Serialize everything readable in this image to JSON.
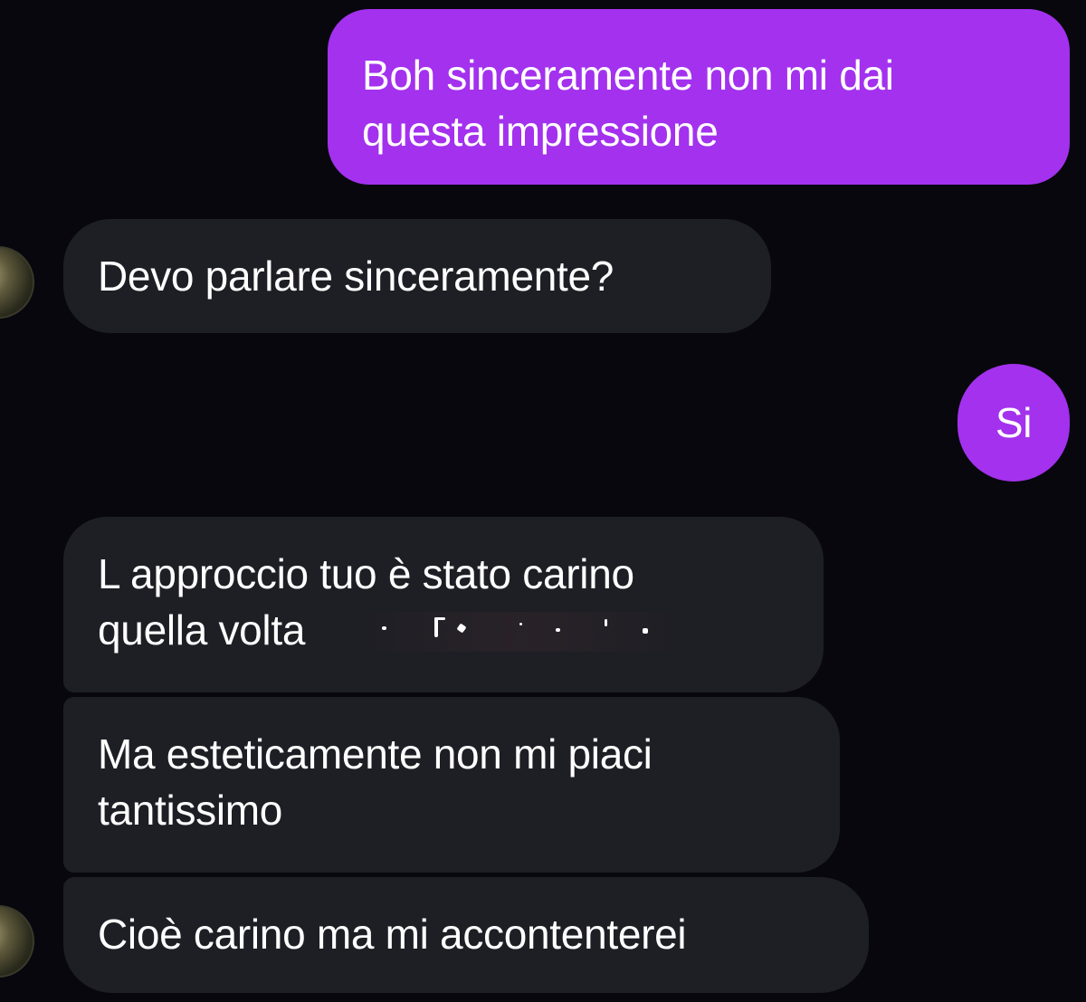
{
  "messages": [
    {
      "direction": "outgoing",
      "text": "Boh sinceramente non mi dai\nquesta impressione"
    },
    {
      "direction": "incoming",
      "text": "Devo parlare sinceramente?"
    },
    {
      "direction": "outgoing",
      "text": "Si"
    },
    {
      "direction": "incoming",
      "text": "L approccio tuo è stato carino\nquella volta"
    },
    {
      "direction": "incoming",
      "text": "Ma esteticamente non mi piaci\ntantissimo"
    },
    {
      "direction": "incoming",
      "text": "Cioè carino ma mi accontenterei"
    }
  ],
  "colors": {
    "background": "#07070d",
    "outgoing_bubble": "#a331ee",
    "incoming_bubble": "#1e1e25",
    "text": "#ffffff"
  },
  "icons": {
    "sender_avatar": "avatar"
  }
}
